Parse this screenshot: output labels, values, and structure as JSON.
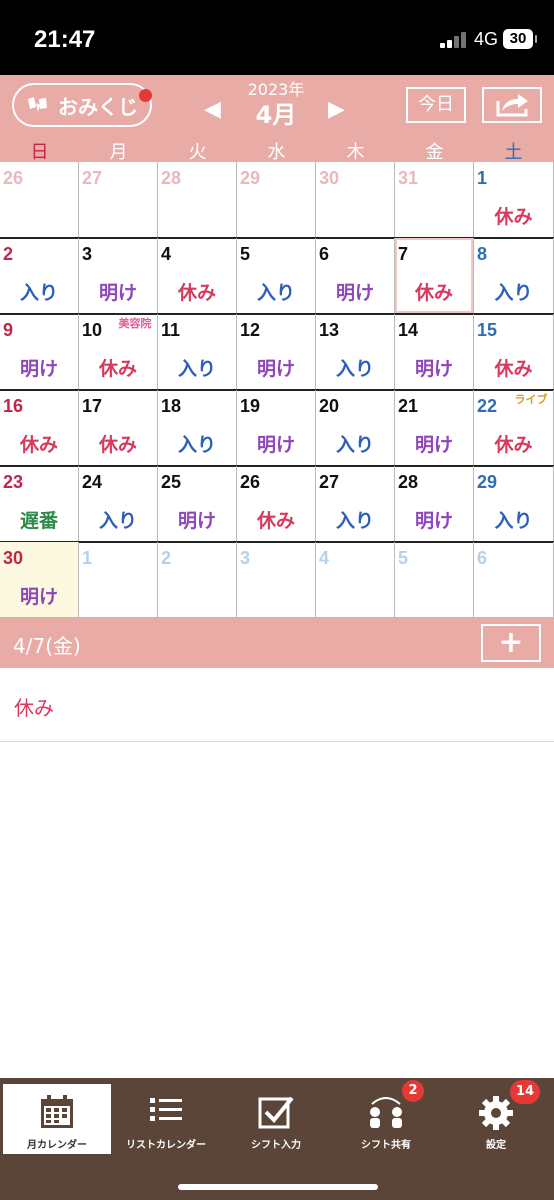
{
  "status_bar": {
    "time": "21:47",
    "network": "4G",
    "battery": "30"
  },
  "header": {
    "omikuji_label": "おみくじ",
    "year": "2023年",
    "month": "4月",
    "today_label": "今日",
    "weekdays": [
      "日",
      "月",
      "火",
      "水",
      "木",
      "金",
      "土"
    ]
  },
  "colors": {
    "accent": "#e8aba6",
    "tabbar": "#5b4438",
    "holiday_red": "#c0264a",
    "saturday_blue": "#2f6db5",
    "shift_rest": "#d63a5e",
    "shift_in": "#2e5fb8",
    "shift_after": "#8e48b8",
    "shift_late": "#2e8b4a"
  },
  "calendar": {
    "weeks": [
      [
        {
          "d": "26",
          "o": 1
        },
        {
          "d": "27",
          "o": 1
        },
        {
          "d": "28",
          "o": 1
        },
        {
          "d": "29",
          "o": 1
        },
        {
          "d": "30",
          "o": 1
        },
        {
          "d": "31",
          "o": 1
        },
        {
          "d": "1",
          "s": "休み"
        }
      ],
      [
        {
          "d": "2",
          "s": "入り"
        },
        {
          "d": "3",
          "s": "明け"
        },
        {
          "d": "4",
          "s": "休み"
        },
        {
          "d": "5",
          "s": "入り"
        },
        {
          "d": "6",
          "s": "明け"
        },
        {
          "d": "7",
          "s": "休み",
          "sel": 1
        },
        {
          "d": "8",
          "s": "入り"
        }
      ],
      [
        {
          "d": "9",
          "s": "明け"
        },
        {
          "d": "10",
          "s": "休み",
          "st": "美容院"
        },
        {
          "d": "11",
          "s": "入り"
        },
        {
          "d": "12",
          "s": "明け"
        },
        {
          "d": "13",
          "s": "入り"
        },
        {
          "d": "14",
          "s": "明け"
        },
        {
          "d": "15",
          "s": "休み"
        }
      ],
      [
        {
          "d": "16",
          "s": "休み"
        },
        {
          "d": "17",
          "s": "休み"
        },
        {
          "d": "18",
          "s": "入り"
        },
        {
          "d": "19",
          "s": "明け"
        },
        {
          "d": "20",
          "s": "入り"
        },
        {
          "d": "21",
          "s": "明け"
        },
        {
          "d": "22",
          "s": "休み",
          "st": "ライブ"
        }
      ],
      [
        {
          "d": "23",
          "s": "遅番"
        },
        {
          "d": "24",
          "s": "入り"
        },
        {
          "d": "25",
          "s": "明け"
        },
        {
          "d": "26",
          "s": "休み"
        },
        {
          "d": "27",
          "s": "入り"
        },
        {
          "d": "28",
          "s": "明け"
        },
        {
          "d": "29",
          "s": "入り"
        }
      ],
      [
        {
          "d": "30",
          "s": "明け",
          "today": 1
        },
        {
          "d": "1",
          "o": 1
        },
        {
          "d": "2",
          "o": 1
        },
        {
          "d": "3",
          "o": 1
        },
        {
          "d": "4",
          "o": 1
        },
        {
          "d": "5",
          "o": 1
        },
        {
          "d": "6",
          "o": 1
        }
      ]
    ]
  },
  "selected": {
    "date_label": "4/7(金)",
    "entries": [
      "休み"
    ]
  },
  "tabbar": {
    "tabs": [
      {
        "label": "月カレンダー",
        "icon": "calendar-icon",
        "active": true
      },
      {
        "label": "リストカレンダー",
        "icon": "list-icon"
      },
      {
        "label": "シフト入力",
        "icon": "checkbox-icon"
      },
      {
        "label": "シフト共有",
        "icon": "share-people-icon",
        "badge": "2"
      },
      {
        "label": "設定",
        "icon": "gear-icon",
        "badge": "14"
      }
    ]
  }
}
